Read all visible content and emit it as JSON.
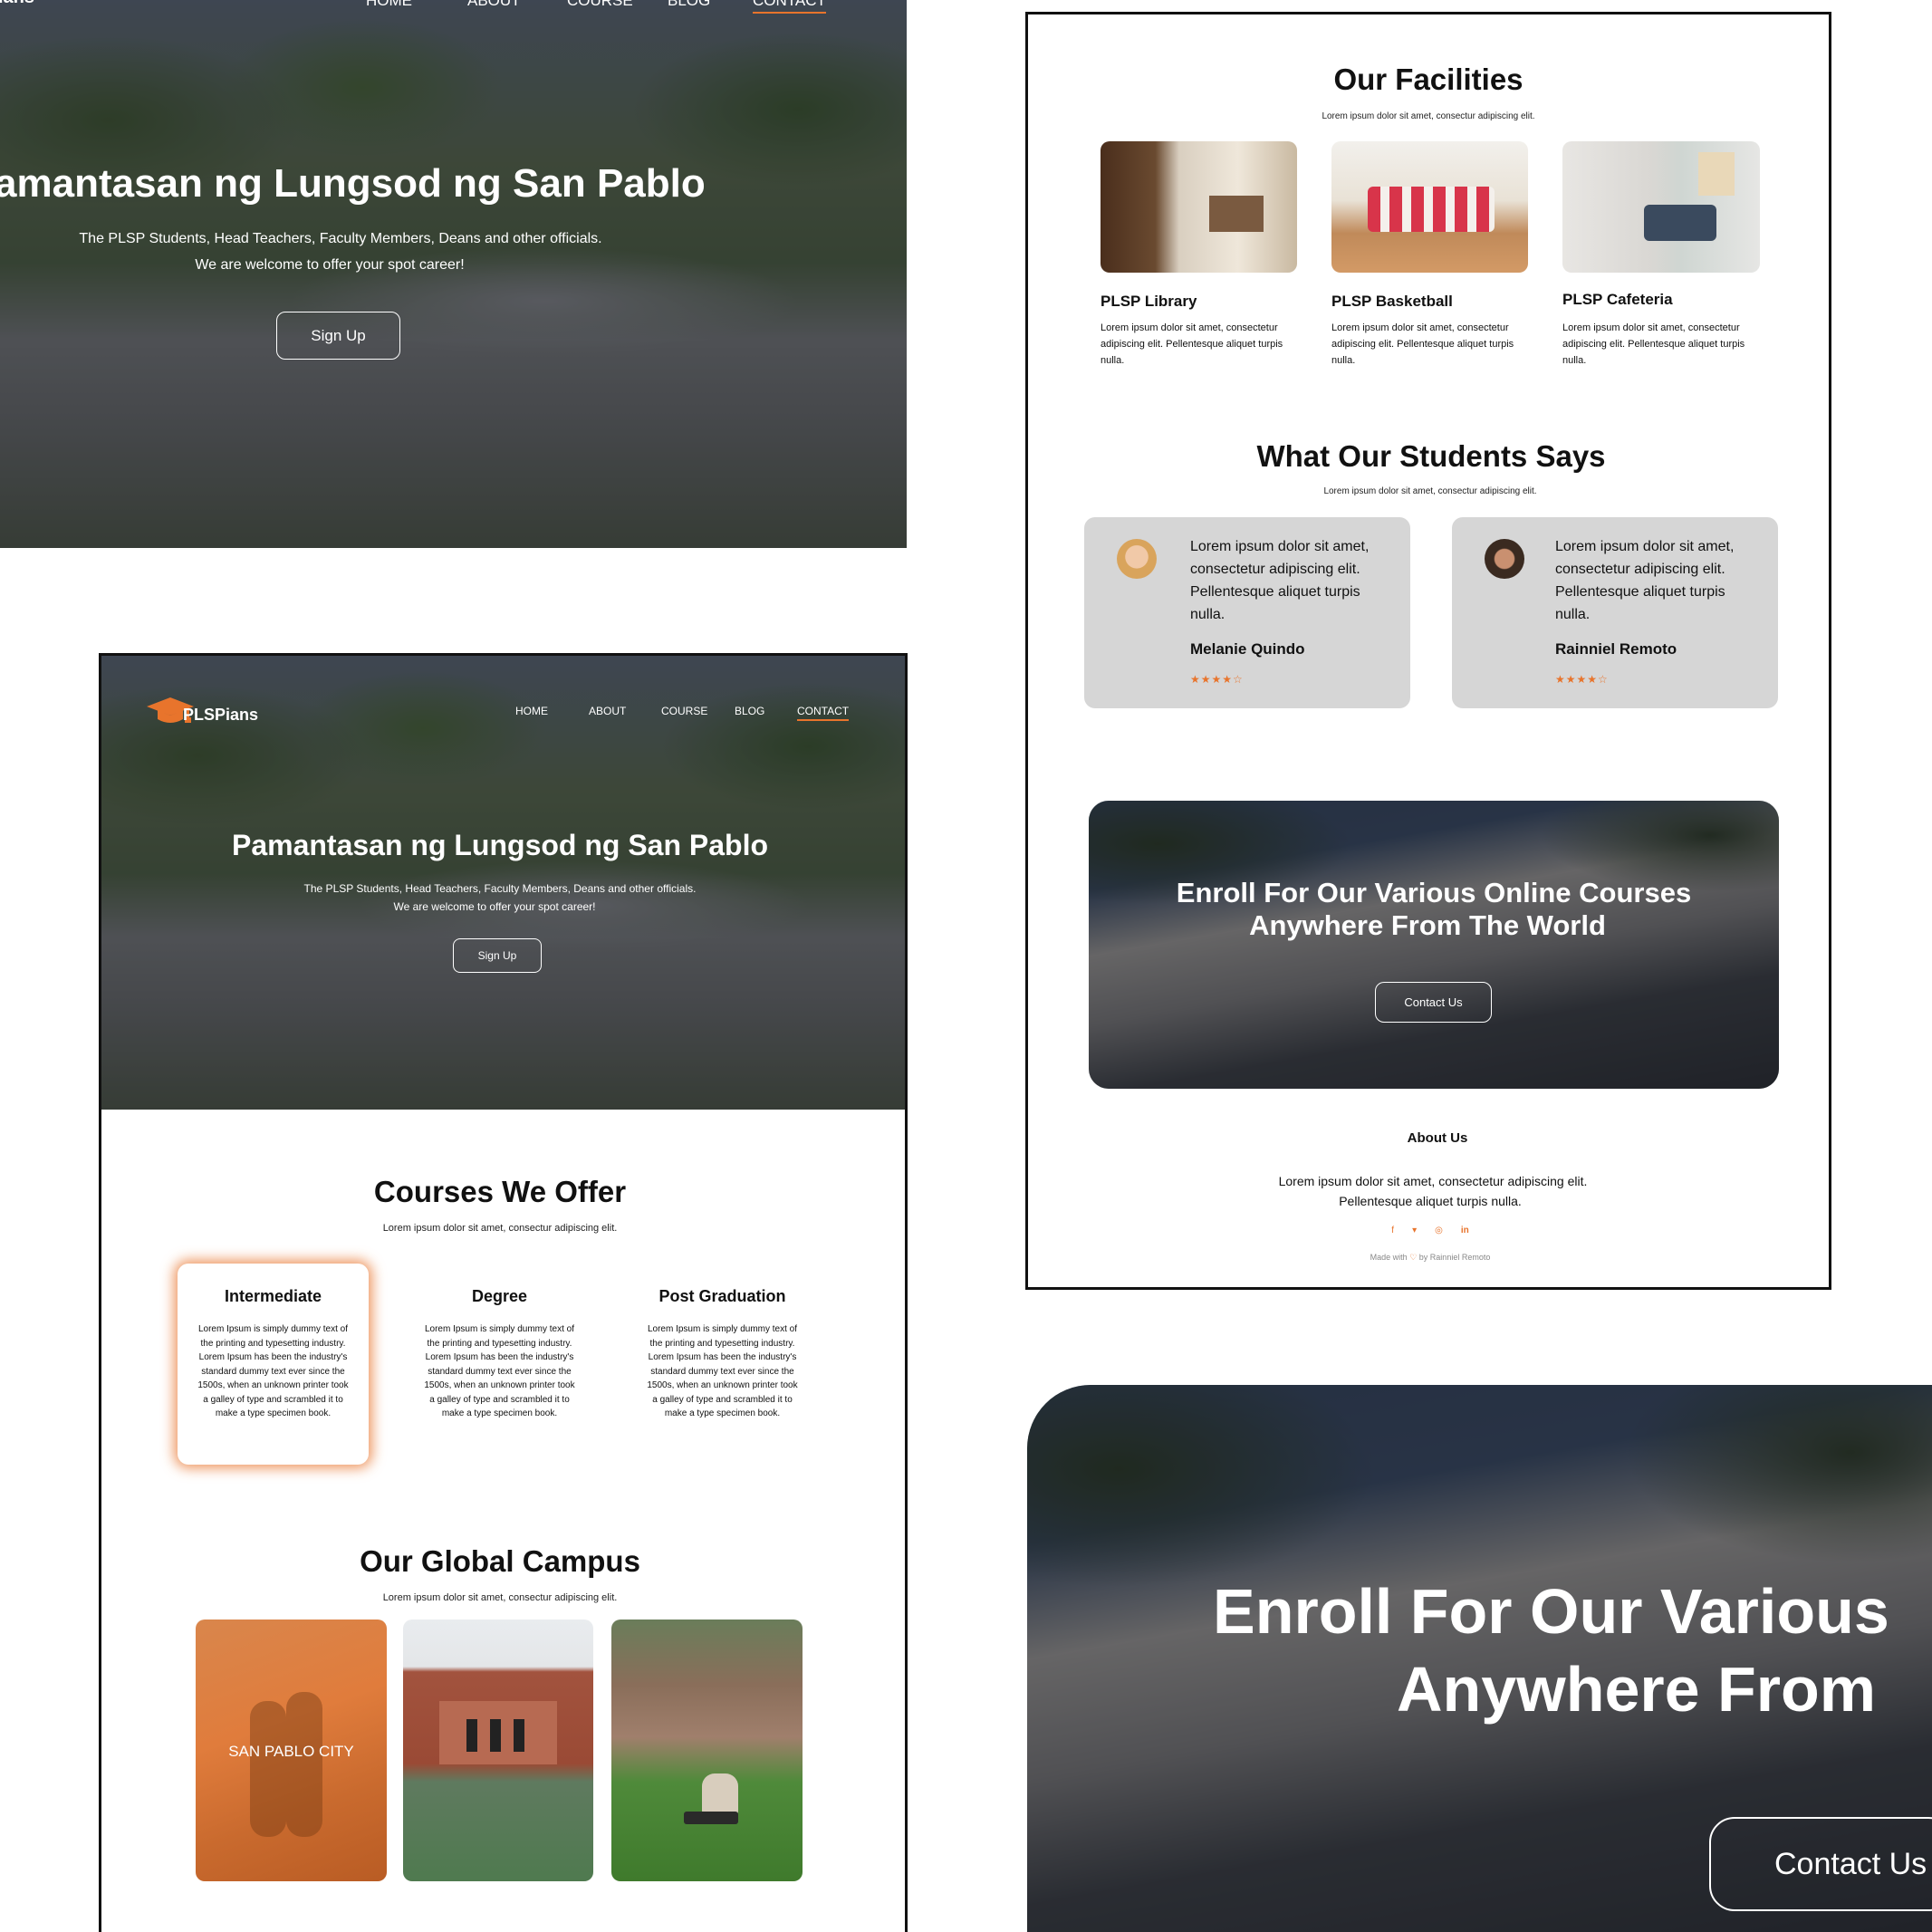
{
  "nav": {
    "logo_text": "PLSPians",
    "logo_text_crop": "ians",
    "items": [
      "HOME",
      "ABOUT",
      "COURSE",
      "BLOG",
      "CONTACT"
    ],
    "active": "CONTACT"
  },
  "hero": {
    "title": "Pamantasan ng Lungsod ng San Pablo",
    "title_crop": "amantasan ng Lungsod ng San Pablo",
    "line1": "The PLSP Students, Head Teachers, Faculty Members, Deans and other officials.",
    "line2": "We are welcome to offer your spot career!",
    "signup": "Sign Up"
  },
  "courses": {
    "title": "Courses We Offer",
    "subtitle": "Lorem ipsum dolor sit amet, consectur adipiscing elit.",
    "items": [
      {
        "name": "Intermediate",
        "text": "Lorem Ipsum is simply dummy text of the printing and typesetting industry. Lorem Ipsum has been the industry's standard dummy text ever since the 1500s, when an unknown printer took a galley of type and scrambled it to make a type specimen book."
      },
      {
        "name": "Degree",
        "text": "Lorem Ipsum is simply dummy text of the printing and typesetting industry. Lorem Ipsum has been the industry's standard dummy text ever since the 1500s, when an unknown printer took a galley of type and scrambled it to make a type specimen book."
      },
      {
        "name": "Post Graduation",
        "text": "Lorem Ipsum is simply dummy text of the printing and typesetting industry. Lorem Ipsum has been the industry's standard dummy text ever since the 1500s, when an unknown printer took a galley of type and scrambled it to make a type specimen book."
      }
    ]
  },
  "campus": {
    "title": "Our Global Campus",
    "subtitle": "Lorem ipsum dolor sit amet, consectur adipiscing elit.",
    "overlay_label": "SAN PABLO CITY"
  },
  "facilities": {
    "title": "Our Facilities",
    "subtitle": "Lorem ipsum dolor sit amet, consectur adipiscing elit.",
    "items": [
      {
        "name": "PLSP Library",
        "text": "Lorem ipsum dolor sit amet, consectetur adipiscing elit. Pellentesque aliquet turpis nulla."
      },
      {
        "name": "PLSP Basketball",
        "text": "Lorem ipsum dolor sit amet, consectetur adipiscing elit. Pellentesque aliquet turpis nulla."
      },
      {
        "name": "PLSP Cafeteria",
        "text": "Lorem ipsum dolor sit amet, consectetur adipiscing elit. Pellentesque aliquet turpis nulla."
      }
    ]
  },
  "testimonials": {
    "title": "What Our Students Says",
    "subtitle": "Lorem ipsum dolor sit amet, consectur adipiscing elit.",
    "items": [
      {
        "quote": "Lorem ipsum dolor sit amet, consectetur adipiscing elit. Pellentesque aliquet turpis nulla.",
        "name": "Melanie Quindo",
        "rating": 4,
        "max": 5
      },
      {
        "quote": "Lorem ipsum dolor sit amet, consectetur adipiscing elit. Pellentesque aliquet turpis nulla.",
        "name": "Rainniel Remoto",
        "rating": 4,
        "max": 5
      }
    ]
  },
  "enroll": {
    "line1": "Enroll For Our Various Online Courses",
    "line2": "Anywhere From The World",
    "line1_crop": "Enroll For Our Various",
    "line2_crop": "Anywhere From",
    "button": "Contact Us"
  },
  "footer": {
    "about_title": "About Us",
    "about_line1": "Lorem ipsum dolor sit amet, consectetur adipiscing elit.",
    "about_line2": "Pellentesque aliquet turpis nulla.",
    "social": [
      "facebook-icon",
      "twitter-icon",
      "instagram-icon",
      "linkedin-icon"
    ],
    "credit_prefix": "Made with",
    "credit_suffix": "by Rainniel Remoto"
  },
  "colors": {
    "accent": "#e8742c",
    "card_grey": "#d6d6d6",
    "frame": "#111111"
  }
}
